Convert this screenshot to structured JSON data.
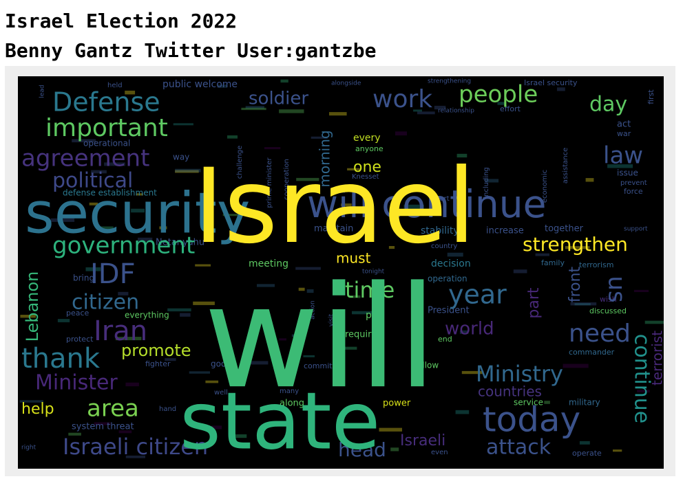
{
  "header": {
    "title": "Israel Election 2022",
    "subtitle": "Benny Gantz Twitter User:gantzbe"
  },
  "wordcloud": {
    "background": "#000000",
    "palette": [
      "#fde725",
      "#5ec962",
      "#21918c",
      "#3b528b",
      "#440154",
      "#35b779",
      "#31688e"
    ],
    "words": [
      {
        "text": "will",
        "color": "#3cbb75"
      },
      {
        "text": "Israel",
        "color": "#fde725"
      },
      {
        "text": "state",
        "color": "#2fb47c"
      },
      {
        "text": "security",
        "color": "#2c728e"
      },
      {
        "text": "will continue",
        "color": "#3b528b"
      },
      {
        "text": "Defense",
        "color": "#2a788e"
      },
      {
        "text": "important",
        "color": "#5ec962"
      },
      {
        "text": "work",
        "color": "#3b528b"
      },
      {
        "text": "people",
        "color": "#6ccd5a"
      },
      {
        "text": "soldier",
        "color": "#3b528b"
      },
      {
        "text": "day",
        "color": "#5ec962"
      },
      {
        "text": "agreement",
        "color": "#46337e"
      },
      {
        "text": "political",
        "color": "#3e4989"
      },
      {
        "text": "law",
        "color": "#3b528b"
      },
      {
        "text": "government",
        "color": "#2db27d"
      },
      {
        "text": "strengthen",
        "color": "#fde725"
      },
      {
        "text": "IDF",
        "color": "#3b528b"
      },
      {
        "text": "citizen",
        "color": "#31688e"
      },
      {
        "text": "Iran",
        "color": "#472d7b"
      },
      {
        "text": "thank",
        "color": "#2a788e"
      },
      {
        "text": "Minister",
        "color": "#482878"
      },
      {
        "text": "time",
        "color": "#5ec962"
      },
      {
        "text": "year",
        "color": "#31688e"
      },
      {
        "text": "need",
        "color": "#3b528b"
      },
      {
        "text": "Ministry",
        "color": "#31688e"
      },
      {
        "text": "today",
        "color": "#3b528b"
      },
      {
        "text": "area",
        "color": "#7ad151"
      },
      {
        "text": "Israeli citizen",
        "color": "#3e4989"
      },
      {
        "text": "head",
        "color": "#3b528b"
      },
      {
        "text": "attack",
        "color": "#3b528b"
      },
      {
        "text": "promote",
        "color": "#b5de2b"
      },
      {
        "text": "continue",
        "color": "#21918c"
      },
      {
        "text": "Lebanon",
        "color": "#35b779"
      },
      {
        "text": "one",
        "color": "#d0e11c"
      },
      {
        "text": "morning",
        "color": "#31688e"
      },
      {
        "text": "must",
        "color": "#fde725"
      },
      {
        "text": "us",
        "color": "#3b528b"
      },
      {
        "text": "front",
        "color": "#3b528b"
      },
      {
        "text": "part",
        "color": "#482878"
      },
      {
        "text": "world",
        "color": "#482878"
      },
      {
        "text": "terrorist",
        "color": "#482878"
      },
      {
        "text": "help",
        "color": "#d8e219"
      },
      {
        "text": "Israeli",
        "color": "#472d7b"
      },
      {
        "text": "countries",
        "color": "#46337e"
      },
      {
        "text": "Netanyahu",
        "color": "#3b528b"
      },
      {
        "text": "meeting",
        "color": "#5ec962"
      },
      {
        "text": "decision",
        "color": "#2a788e"
      },
      {
        "text": "put",
        "color": "#5ec962"
      },
      {
        "text": "required",
        "color": "#5ec962"
      },
      {
        "text": "President",
        "color": "#3b528b"
      },
      {
        "text": "every",
        "color": "#c2df23"
      },
      {
        "text": "anyone",
        "color": "#5ec962"
      },
      {
        "text": "Knesset",
        "color": "#3b528b"
      },
      {
        "text": "maintain",
        "color": "#3b528b"
      },
      {
        "text": "stability",
        "color": "#31688e"
      },
      {
        "text": "increase",
        "color": "#3b528b"
      },
      {
        "text": "together",
        "color": "#3b528b"
      },
      {
        "text": "public welcome",
        "color": "#3b528b"
      },
      {
        "text": "defense establishment",
        "color": "#2a788e"
      },
      {
        "text": "operational",
        "color": "#3b528b"
      },
      {
        "text": "family",
        "color": "#31688e"
      },
      {
        "text": "terrorism",
        "color": "#31688e"
      },
      {
        "text": "wish",
        "color": "#472d7b"
      },
      {
        "text": "discussed",
        "color": "#5ec962"
      },
      {
        "text": "commander",
        "color": "#31688e"
      },
      {
        "text": "military",
        "color": "#31688e"
      },
      {
        "text": "service",
        "color": "#5ec962"
      },
      {
        "text": "power",
        "color": "#d8e219"
      },
      {
        "text": "along",
        "color": "#5ec962"
      },
      {
        "text": "system threat",
        "color": "#3b528b"
      },
      {
        "text": "everything",
        "color": "#5ec962"
      },
      {
        "text": "bring",
        "color": "#3b528b"
      },
      {
        "text": "peace",
        "color": "#3b528b"
      },
      {
        "text": "protect",
        "color": "#3b528b"
      },
      {
        "text": "good",
        "color": "#3b528b"
      },
      {
        "text": "fighter",
        "color": "#3b528b"
      },
      {
        "text": "committee",
        "color": "#3b528b"
      },
      {
        "text": "allow",
        "color": "#5ec962"
      },
      {
        "text": "operation",
        "color": "#31688e"
      },
      {
        "text": "end",
        "color": "#5ec962"
      },
      {
        "text": "force",
        "color": "#3b528b"
      },
      {
        "text": "act",
        "color": "#3b528b"
      },
      {
        "text": "war",
        "color": "#3b528b"
      },
      {
        "text": "issue",
        "color": "#3b528b"
      },
      {
        "text": "prevent",
        "color": "#3b528b"
      },
      {
        "text": "first",
        "color": "#3b528b"
      },
      {
        "text": "Israel security",
        "color": "#3b528b"
      },
      {
        "text": "strengthening",
        "color": "#3b528b"
      },
      {
        "text": "alongside",
        "color": "#3b528b"
      },
      {
        "text": "held",
        "color": "#3b528b"
      },
      {
        "text": "lead",
        "color": "#3b528b"
      },
      {
        "text": "support",
        "color": "#3b528b"
      },
      {
        "text": "operate",
        "color": "#3b528b"
      },
      {
        "text": "visit",
        "color": "#3b528b"
      },
      {
        "text": "tonight",
        "color": "#3b528b"
      },
      {
        "text": "way",
        "color": "#3b528b"
      },
      {
        "text": "cooperation",
        "color": "#3b528b"
      },
      {
        "text": "prime minister",
        "color": "#3b528b"
      },
      {
        "text": "challenge",
        "color": "#3b528b"
      },
      {
        "text": "effort",
        "color": "#3b528b"
      },
      {
        "text": "relationship",
        "color": "#3b528b"
      },
      {
        "text": "including",
        "color": "#3b528b"
      },
      {
        "text": "economic",
        "color": "#3b528b"
      },
      {
        "text": "assistance",
        "color": "#3b528b"
      },
      {
        "text": "heart",
        "color": "#3b528b"
      },
      {
        "text": "country",
        "color": "#3b528b"
      },
      {
        "text": "hand",
        "color": "#3b528b"
      },
      {
        "text": "well",
        "color": "#3b528b"
      },
      {
        "text": "even",
        "color": "#3b528b"
      },
      {
        "text": "many",
        "color": "#3b528b"
      },
      {
        "text": "action",
        "color": "#3b528b"
      },
      {
        "text": "right",
        "color": "#3b528b"
      }
    ]
  }
}
